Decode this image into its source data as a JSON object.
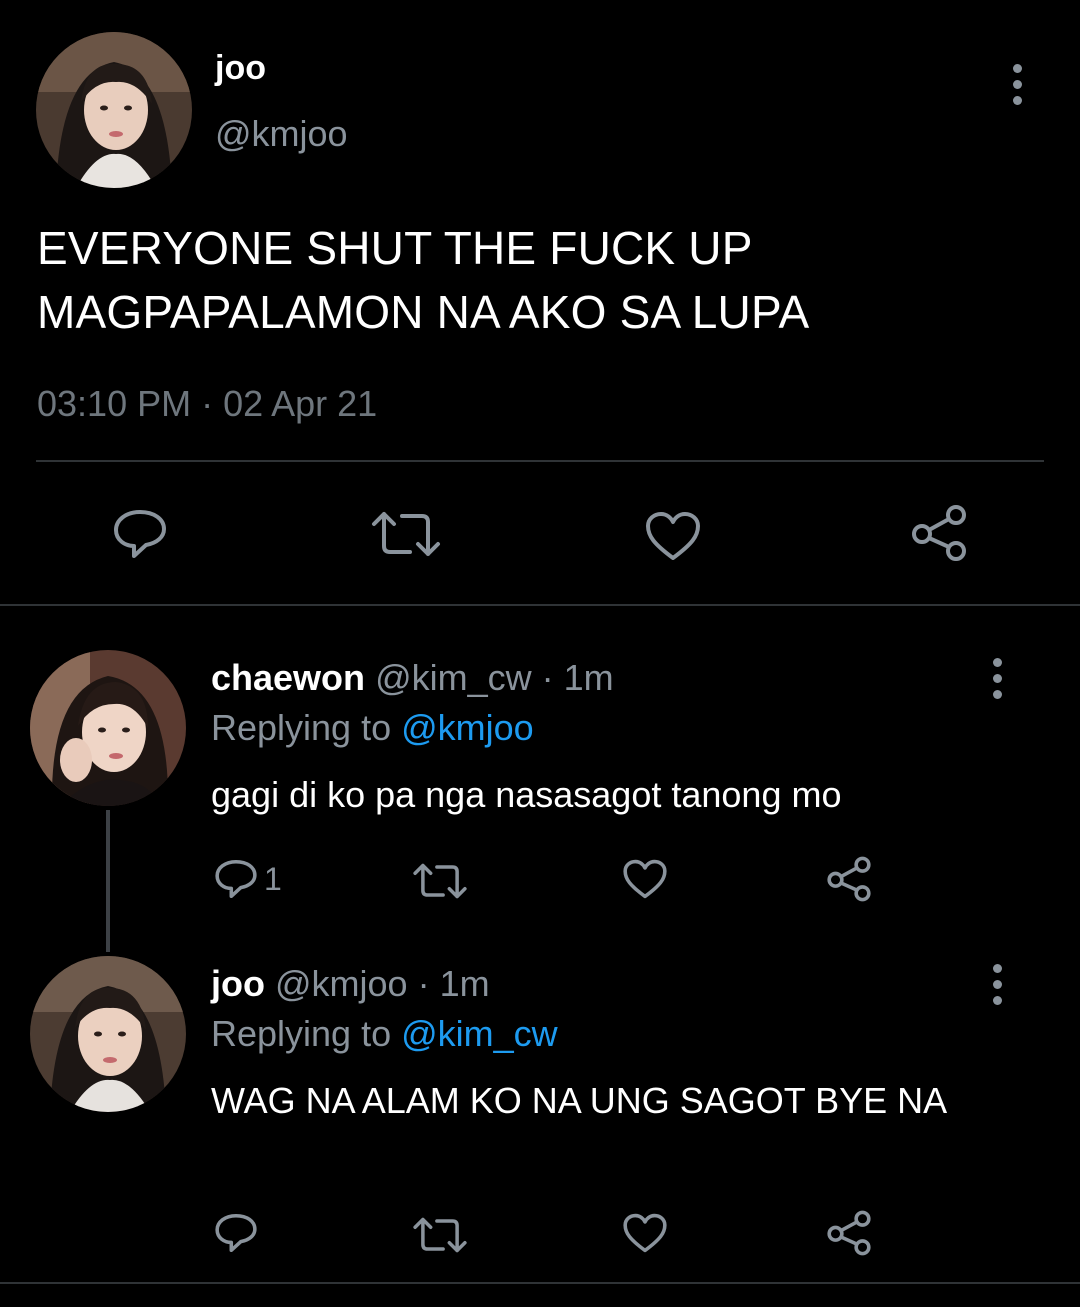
{
  "main_tweet": {
    "author_name": "joo",
    "author_handle": "@kmjoo",
    "text_lines": [
      "EVERYONE SHUT THE FUCK UP",
      "MAGPAPALAMON NA AKO SA LUPA"
    ],
    "timestamp": "03:10 PM · 02 Apr 21",
    "actions": [
      "reply-icon",
      "retweet-icon",
      "like-icon",
      "share-icon"
    ]
  },
  "replies": [
    {
      "author_name": "chaewon",
      "author_handle": "@kim_cw",
      "time_ago": "1m",
      "replying_label": "Replying to",
      "replying_to": "@kmjoo",
      "text": "gagi di ko pa nga nasasagot tanong mo",
      "reply_count": "1"
    },
    {
      "author_name": "joo",
      "author_handle": "@kmjoo",
      "time_ago": "1m",
      "replying_label": "Replying to",
      "replying_to": "@kim_cw",
      "text": "WAG NA ALAM KO NA UNG SAGOT BYE NA",
      "reply_count": ""
    }
  ],
  "colors": {
    "background": "#000000",
    "secondary_text": "#8a939c",
    "mention": "#1d9bf0",
    "divider": "#2f3336"
  }
}
